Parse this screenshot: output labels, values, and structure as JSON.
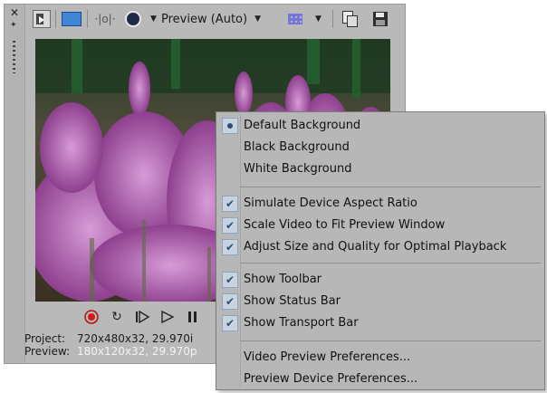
{
  "toolbar": {
    "preview_label": "Preview (Auto)",
    "icons": [
      "close-icon",
      "pin-icon",
      "split-screen-icon",
      "monitor-icon",
      "overlay-icon",
      "mode-icon",
      "grid-icon",
      "copy-snapshot-icon",
      "save-snapshot-icon"
    ]
  },
  "transport": [
    "record-icon",
    "loop-icon",
    "play-from-start-icon",
    "play-icon",
    "pause-icon"
  ],
  "status": {
    "project_label": "Project:",
    "project_value": "720x480x32, 29.970i",
    "preview_label": "Preview:",
    "preview_value": "180x120x32, 29.970p"
  },
  "menu": {
    "items": [
      {
        "label": "Default Background",
        "mark": "radio"
      },
      {
        "label": "Black Background",
        "mark": "none"
      },
      {
        "label": "White Background",
        "mark": "none"
      },
      {
        "label": "Simulate Device Aspect Ratio",
        "mark": "check"
      },
      {
        "label": "Scale Video to Fit Preview Window",
        "mark": "check"
      },
      {
        "label": "Adjust Size and Quality for Optimal Playback",
        "mark": "check"
      },
      {
        "label": "Show Toolbar",
        "mark": "check"
      },
      {
        "label": "Show Status Bar",
        "mark": "check"
      },
      {
        "label": "Show Transport Bar",
        "mark": "check"
      },
      {
        "label": "Video Preview Preferences...",
        "mark": "none"
      },
      {
        "label": "Preview Device Preferences...",
        "mark": "none"
      }
    ]
  },
  "colors": {
    "video_sky": "#2a4a2a",
    "flower": "#b04fb0",
    "menu_bg": "#b7b7b7",
    "check": "#2b4f7a"
  }
}
